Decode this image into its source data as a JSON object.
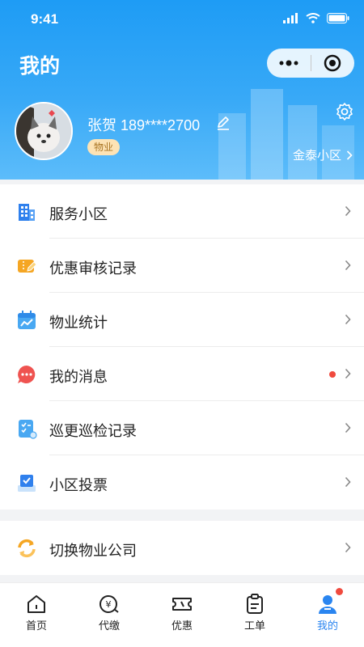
{
  "status_bar": {
    "time": "9:41"
  },
  "header": {
    "title": "我的"
  },
  "profile": {
    "name_phone": "张贺 189****2700",
    "role": "物业",
    "community": "金泰小区"
  },
  "menu": {
    "items": [
      {
        "label": "服务小区",
        "icon": "building-icon"
      },
      {
        "label": "优惠审核记录",
        "icon": "coupon-edit-icon"
      },
      {
        "label": "物业统计",
        "icon": "calendar-chart-icon"
      },
      {
        "label": "我的消息",
        "icon": "message-icon",
        "unread": true
      },
      {
        "label": "巡更巡检记录",
        "icon": "checklist-icon"
      },
      {
        "label": "小区投票",
        "icon": "vote-icon"
      }
    ],
    "switch_company": {
      "label": "切换物业公司",
      "icon": "switch-icon"
    }
  },
  "tabbar": {
    "tabs": [
      {
        "label": "首页",
        "icon": "home-icon"
      },
      {
        "label": "代缴",
        "icon": "payment-icon"
      },
      {
        "label": "优惠",
        "icon": "ticket-icon"
      },
      {
        "label": "工单",
        "icon": "clipboard-icon"
      },
      {
        "label": "我的",
        "icon": "profile-icon",
        "active": true,
        "badge": true
      }
    ]
  },
  "colors": {
    "accent": "#2a85f0",
    "header": "#1e9cf5",
    "badge": "#f04a3e"
  }
}
